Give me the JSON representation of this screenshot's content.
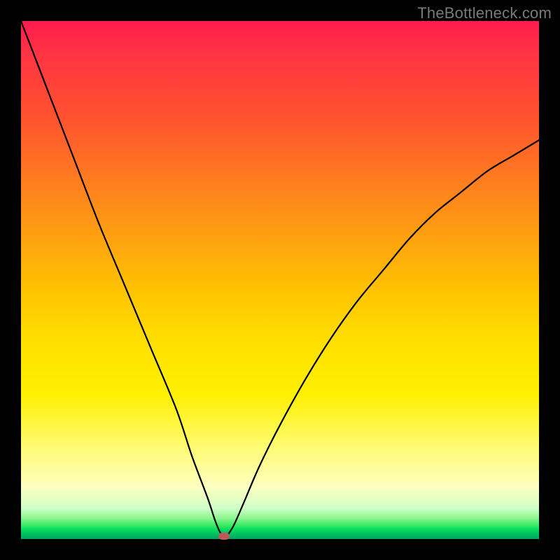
{
  "watermark": "TheBottleneck.com",
  "chart_data": {
    "type": "line",
    "title": "",
    "xlabel": "",
    "ylabel": "",
    "xlim": [
      0,
      100
    ],
    "ylim": [
      0,
      100
    ],
    "grid": false,
    "legend": false,
    "series": [
      {
        "name": "bottleneck-curve",
        "x": [
          0,
          5,
          10,
          15,
          20,
          25,
          30,
          33,
          36,
          37.5,
          38.5,
          39.5,
          41,
          43,
          46,
          50,
          55,
          60,
          65,
          70,
          75,
          80,
          85,
          90,
          95,
          100
        ],
        "values": [
          100,
          87,
          74,
          61,
          49,
          37,
          25,
          16,
          8,
          3.5,
          1.2,
          0.5,
          2.5,
          7,
          14,
          22,
          31,
          39,
          46,
          52,
          58,
          63,
          67,
          71,
          74,
          77
        ]
      }
    ],
    "marker": {
      "x": 39.2,
      "y": 0.5
    },
    "background_gradient": {
      "top": "#ff1a4d",
      "mid": "#ffe000",
      "bottom": "#00a860"
    }
  }
}
